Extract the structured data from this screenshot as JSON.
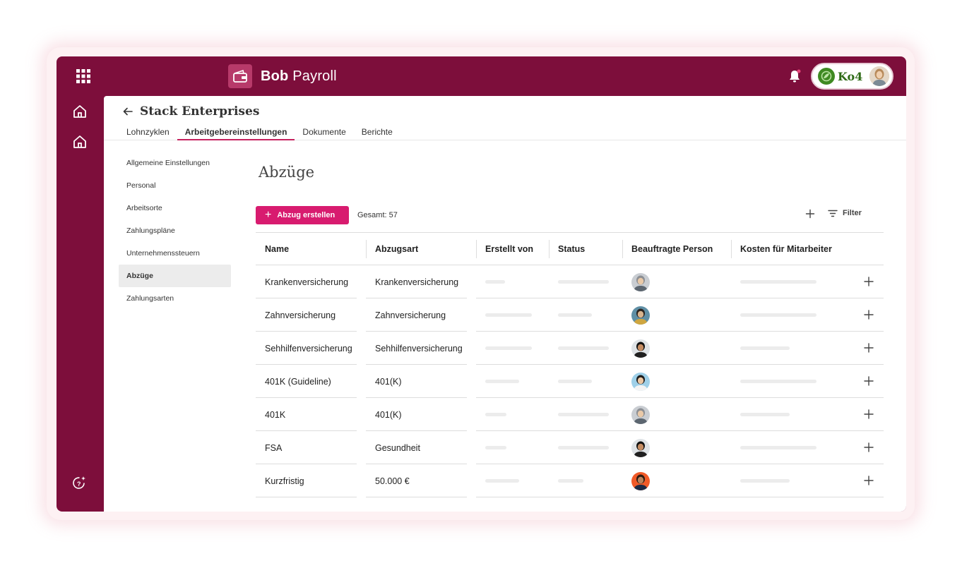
{
  "app": {
    "brand_name_bold": "Bob",
    "brand_name_light": "Payroll",
    "company_badge": "Ko4",
    "accent_color": "#7d0e3b",
    "button_color": "#d81b6f"
  },
  "header": {
    "company_title": "Stack Enterprises",
    "tabs": [
      {
        "label": "Lohnzyklen",
        "active": false
      },
      {
        "label": "Arbeitgebereinstellungen",
        "active": true
      },
      {
        "label": "Dokumente",
        "active": false
      },
      {
        "label": "Berichte",
        "active": false
      }
    ]
  },
  "subnav": {
    "items": [
      {
        "label": "Allgemeine Einstellungen",
        "active": false
      },
      {
        "label": "Personal",
        "active": false
      },
      {
        "label": "Arbeitsorte",
        "active": false
      },
      {
        "label": "Zahlungspläne",
        "active": false
      },
      {
        "label": "Unternehmenssteuern",
        "active": false
      },
      {
        "label": "Abzüge",
        "active": true
      },
      {
        "label": "Zahlungsarten",
        "active": false
      }
    ]
  },
  "main": {
    "title": "Abzüge",
    "create_button": "Abzug erstellen",
    "total_label": "Gesamt:",
    "total_count": "57",
    "filter_label": "Filter"
  },
  "table": {
    "columns": [
      "Name",
      "Abzugsart",
      "Erstellt von",
      "Status",
      "Beauftragte Person",
      "Kosten für Mitarbeiter"
    ],
    "rows": [
      {
        "name": "Krankenversicherung",
        "type": "Krankenversicherung",
        "avatar": "avatar-gray-hair"
      },
      {
        "name": "Zahnversicherung",
        "type": "Zahnversicherung",
        "avatar": "avatar-dark-hair"
      },
      {
        "name": "Sehhilfenversicherung",
        "type": "Sehhilfenversicherung",
        "avatar": "avatar-black-hair"
      },
      {
        "name": "401K (Guideline)",
        "type": "401(K)",
        "avatar": "avatar-light-blue"
      },
      {
        "name": "401K",
        "type": "401(K)",
        "avatar": "avatar-gray-hair"
      },
      {
        "name": "FSA",
        "type": "Gesundheit",
        "avatar": "avatar-black-hair"
      },
      {
        "name": "Kurzfristig",
        "type": "50.000 €",
        "avatar": "avatar-orange"
      }
    ]
  }
}
